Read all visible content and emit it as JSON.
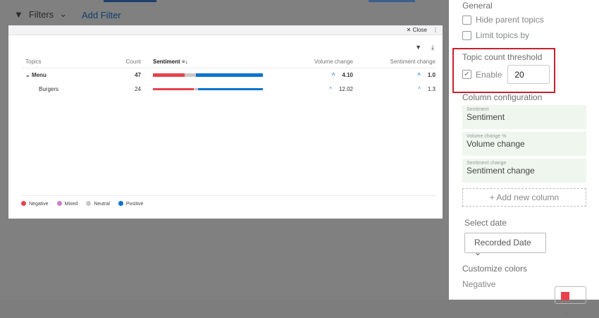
{
  "background": {
    "filters_label": "Filters",
    "add_filter": "Add Filter"
  },
  "modal": {
    "close": "Close",
    "columns": [
      "Topics",
      "Count",
      "Sentiment",
      "Volume change",
      "Sentiment change"
    ],
    "rows": [
      {
        "topic": "Menu",
        "count": "47",
        "sentiment": {
          "negative": 0.29,
          "neutral": 0.1,
          "positive": 0.61
        },
        "volume_change": "4.10",
        "sentiment_change": "1.0",
        "bold": true
      },
      {
        "topic": "Burgers",
        "count": "24",
        "sentiment": {
          "negative": 0.37,
          "neutral": 0.04,
          "positive": 0.59
        },
        "volume_change": "12.02",
        "sentiment_change": "1.3",
        "bold": false
      }
    ],
    "legend": [
      {
        "label": "Negative",
        "color": "#e8424f"
      },
      {
        "label": "Mixed",
        "color": "#cf7fc9"
      },
      {
        "label": "Neutral",
        "color": "#c8c8c8"
      },
      {
        "label": "Positive",
        "color": "#0a72d0"
      }
    ]
  },
  "panel": {
    "general": "General",
    "hide_parent": "Hide parent topics",
    "limit_topics": "Limit topics by",
    "threshold_title": "Topic count threshold",
    "enable": "Enable",
    "threshold_value": "20",
    "column_config": "Column configuration",
    "columns": [
      {
        "sub": "Sentiment",
        "value": "Sentiment"
      },
      {
        "sub": "Volume change %",
        "value": "Volume change"
      },
      {
        "sub": "Sentiment change",
        "value": "Sentiment change"
      }
    ],
    "add_column": "+ Add new column",
    "select_date": "Select date",
    "date_value": "Recorded Date",
    "customize_colors": "Customize colors",
    "negative": "Negative",
    "negative_color": "#e8424f"
  }
}
